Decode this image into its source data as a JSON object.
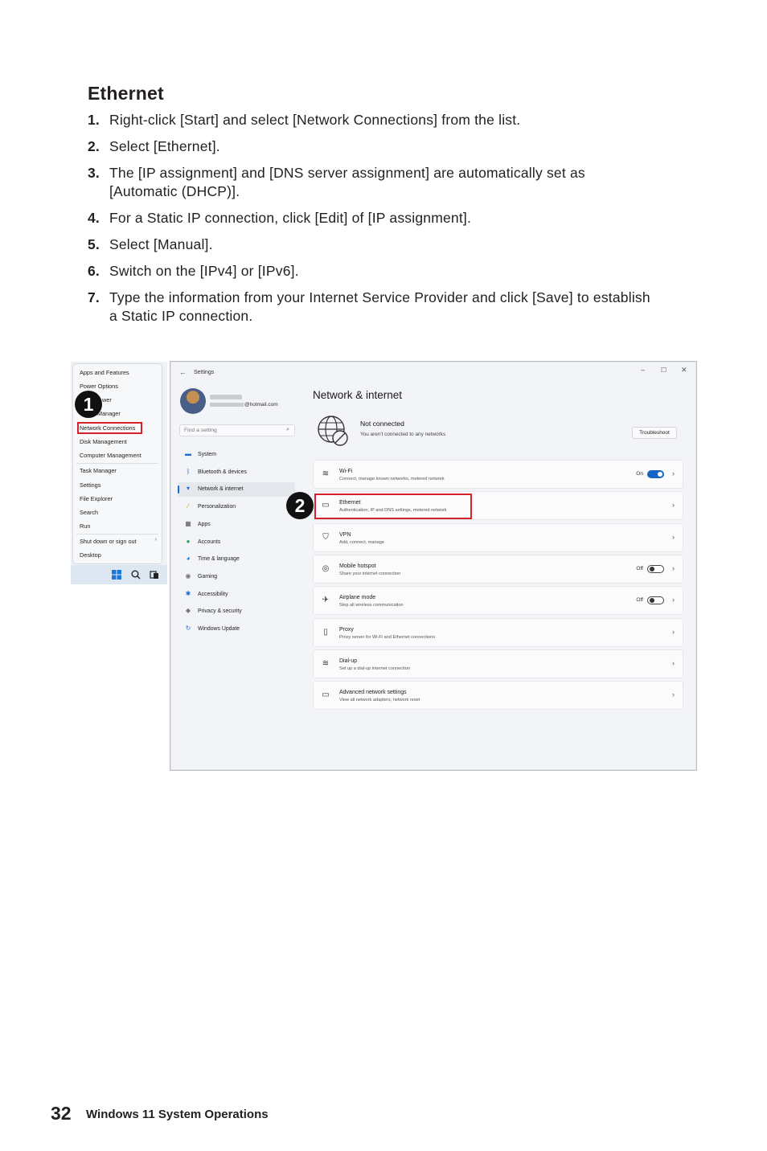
{
  "section": {
    "title": "Ethernet",
    "steps": [
      {
        "num": "1.",
        "text": "Right-click [Start] and select [Network Connections] from the list."
      },
      {
        "num": "2.",
        "text": "Select [Ethernet]."
      },
      {
        "num": "3.",
        "text": "The [IP assignment] and [DNS server assignment] are automatically set as [Automatic (DHCP)]."
      },
      {
        "num": "4.",
        "text": "For a Static IP connection, click [Edit] of [IP assignment]."
      },
      {
        "num": "5.",
        "text": "Select [Manual]."
      },
      {
        "num": "6.",
        "text": "Switch on the [IPv4] or [IPv6]."
      },
      {
        "num": "7.",
        "text": "Type the information from your Internet Service Provider and click [Save] to establish a Static IP connection."
      }
    ]
  },
  "context_menu": {
    "items": [
      "Apps and Features",
      "Power Options",
      "wer",
      "Manager",
      "Network Connections",
      "Disk Management",
      "Computer Management",
      "Task Manager",
      "Settings",
      "File Explorer",
      "Search",
      "Run",
      "Shut down or sign out",
      "Desktop"
    ],
    "arrow": "›"
  },
  "badges": {
    "one": "1",
    "two": "2"
  },
  "settings": {
    "window_title": "Settings",
    "back_glyph": "←",
    "controls": [
      "–",
      "☐",
      "✕"
    ],
    "email": "@hotmail.com",
    "search_placeholder": "Find a setting",
    "nav": [
      {
        "label": "System",
        "icon": "monitor-icon",
        "color": "#1a6fd6"
      },
      {
        "label": "Bluetooth & devices",
        "icon": "bluetooth-icon",
        "color": "#1a6fd6"
      },
      {
        "label": "Network & internet",
        "icon": "wifi-icon",
        "color": "#1a6fd6"
      },
      {
        "label": "Personalization",
        "icon": "brush-icon",
        "color": "#e08a1a"
      },
      {
        "label": "Apps",
        "icon": "apps-icon",
        "color": "#555555"
      },
      {
        "label": "Accounts",
        "icon": "person-icon",
        "color": "#2a9d5c"
      },
      {
        "label": "Time & language",
        "icon": "globe-clock-icon",
        "color": "#1a6fd6"
      },
      {
        "label": "Gaming",
        "icon": "gamepad-icon",
        "color": "#777777"
      },
      {
        "label": "Accessibility",
        "icon": "accessibility-icon",
        "color": "#1a6fd6"
      },
      {
        "label": "Privacy & security",
        "icon": "shield-icon",
        "color": "#777777"
      },
      {
        "label": "Windows Update",
        "icon": "update-icon",
        "color": "#1a6fd6"
      }
    ],
    "page_title": "Network & internet",
    "status_title": "Not connected",
    "status_sub": "You aren't connected to any networks",
    "troubleshoot": "Troubleshoot",
    "cards": [
      {
        "title": "Wi-Fi",
        "sub": "Connect, manage known networks, metered network",
        "icon": "wifi-icon",
        "toggle": "On"
      },
      {
        "title": "Ethernet",
        "sub": "Authentication, IP and DNS settings, metered network",
        "icon": "ethernet-icon",
        "toggle": ""
      },
      {
        "title": "VPN",
        "sub": "Add, connect, manage",
        "icon": "vpn-shield-icon",
        "toggle": ""
      },
      {
        "title": "Mobile hotspot",
        "sub": "Share your internet connection",
        "icon": "hotspot-icon",
        "toggle": "Off"
      },
      {
        "title": "Airplane mode",
        "sub": "Stop all wireless communication",
        "icon": "airplane-icon",
        "toggle": "Off"
      },
      {
        "title": "Proxy",
        "sub": "Proxy server for Wi-Fi and Ethernet connections",
        "icon": "proxy-icon",
        "toggle": ""
      },
      {
        "title": "Dial-up",
        "sub": "Set up a dial-up internet connection",
        "icon": "dialup-icon",
        "toggle": ""
      },
      {
        "title": "Advanced network settings",
        "sub": "View all network adapters, network reset",
        "icon": "adapter-icon",
        "toggle": ""
      }
    ],
    "chevron": "›"
  },
  "footer": {
    "page_number": "32",
    "section_name": "Windows 11 System Operations"
  }
}
